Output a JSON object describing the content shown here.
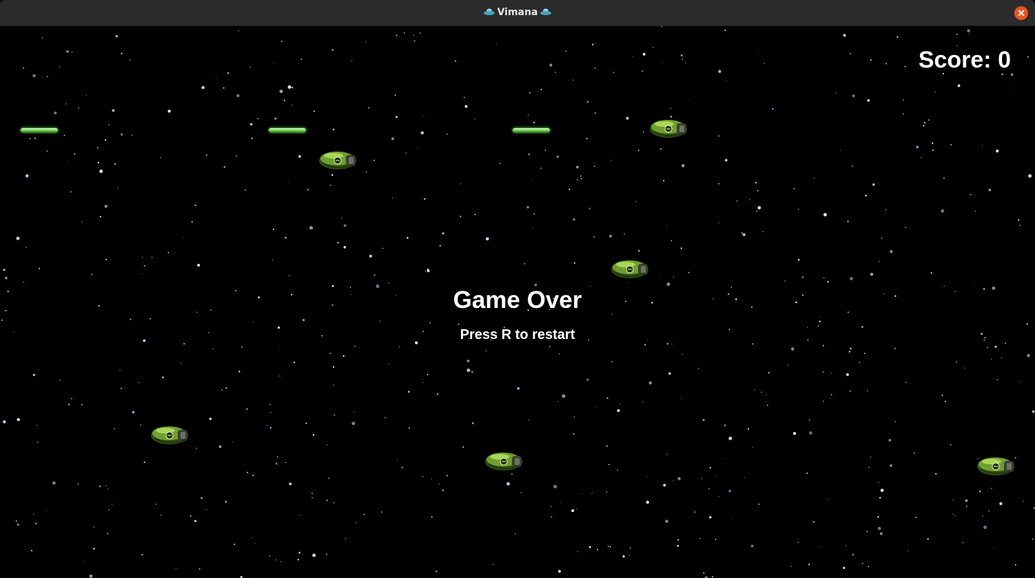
{
  "window": {
    "title": "Vimana",
    "title_icon": "ufo-icon",
    "close_icon": "close-icon",
    "close_glyph": "✕"
  },
  "hud": {
    "score_text": "Score: 0",
    "score": 0
  },
  "overlay": {
    "headline": "Game Over",
    "hint": "Press R to restart"
  },
  "colors": {
    "background": "#000000",
    "ship_hull": "#6fa02f",
    "laser": "#7cff5a",
    "close_button": "#e95420"
  },
  "sprites": {
    "enemy_ship_count": 6,
    "laser_count": 3
  }
}
